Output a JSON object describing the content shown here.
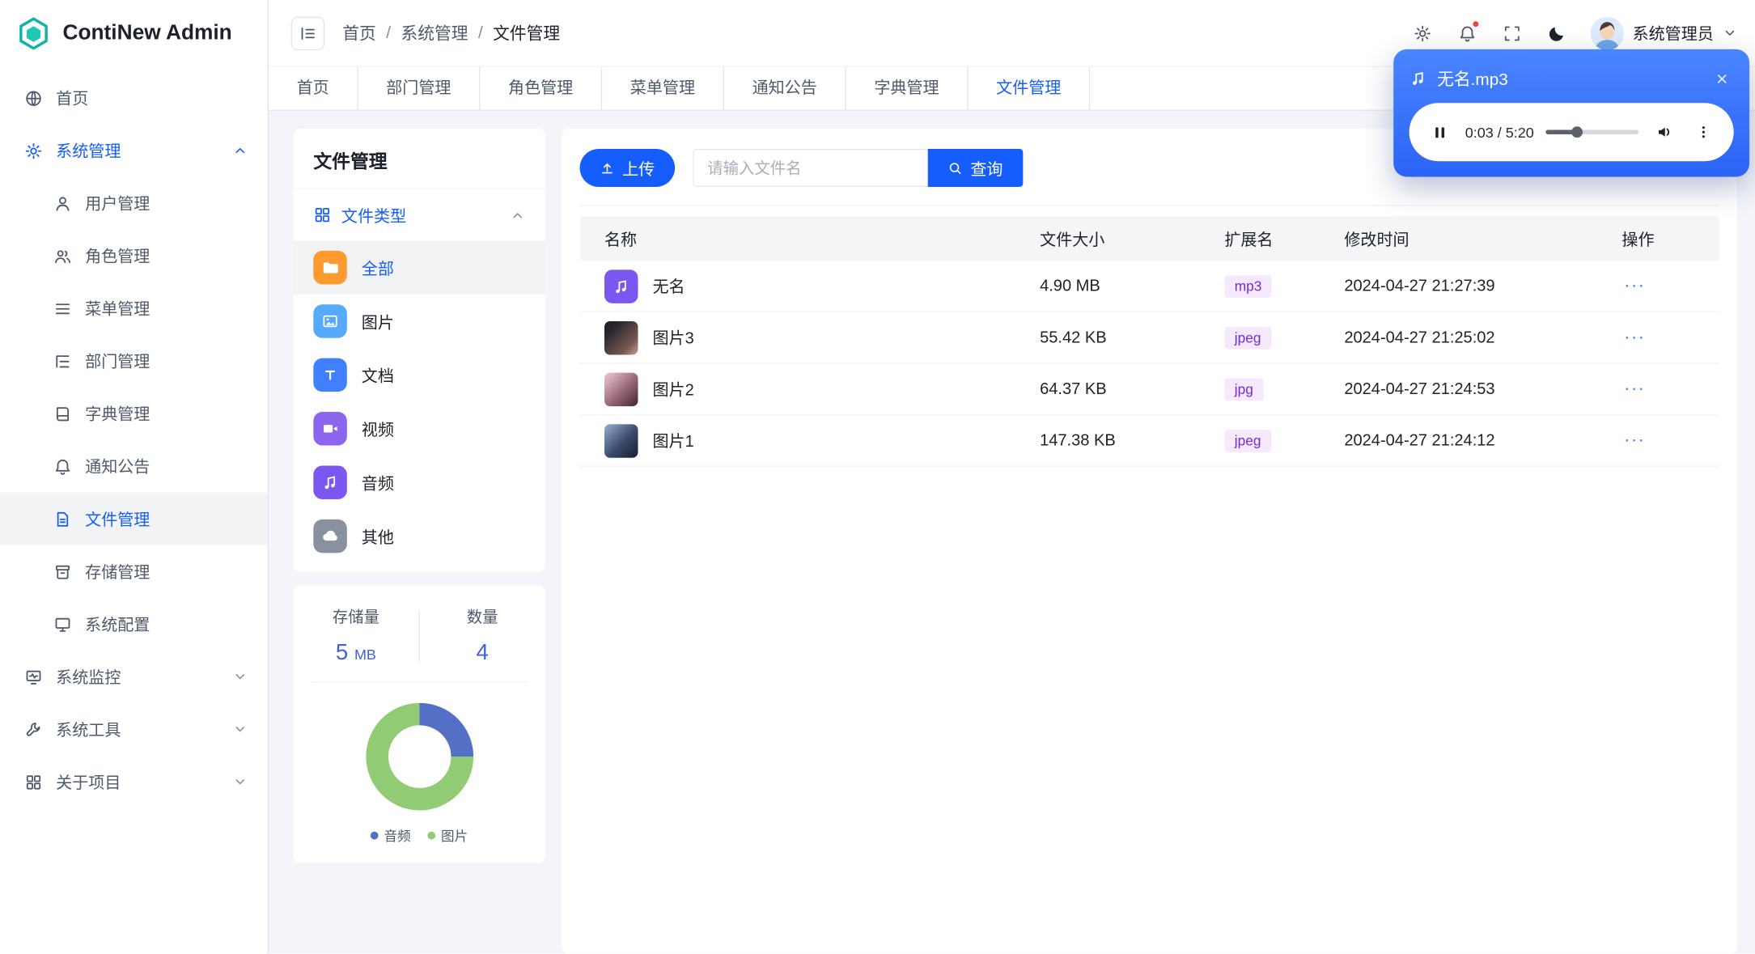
{
  "app": {
    "title": "ContiNew Admin"
  },
  "header": {
    "breadcrumb": [
      "首页",
      "系统管理",
      "文件管理"
    ],
    "separator": "/",
    "user_name": "系统管理员"
  },
  "sidebar": {
    "items": [
      {
        "label": "首页",
        "icon": "home-icon"
      },
      {
        "label": "系统管理",
        "icon": "gear-icon",
        "expanded": true
      },
      {
        "label": "用户管理",
        "icon": "user-icon"
      },
      {
        "label": "角色管理",
        "icon": "users-icon"
      },
      {
        "label": "菜单管理",
        "icon": "list-icon"
      },
      {
        "label": "部门管理",
        "icon": "tree-icon"
      },
      {
        "label": "字典管理",
        "icon": "book-icon"
      },
      {
        "label": "通知公告",
        "icon": "bell-icon"
      },
      {
        "label": "文件管理",
        "icon": "file-icon",
        "active": true
      },
      {
        "label": "存储管理",
        "icon": "archive-icon"
      },
      {
        "label": "系统配置",
        "icon": "monitor-icon"
      },
      {
        "label": "系统监控",
        "icon": "monitor-pulse-icon",
        "collapsed": true
      },
      {
        "label": "系统工具",
        "icon": "wrench-icon",
        "collapsed": true
      },
      {
        "label": "关于项目",
        "icon": "grid-icon",
        "collapsed": true
      }
    ]
  },
  "tabs": [
    "首页",
    "部门管理",
    "角色管理",
    "菜单管理",
    "通知公告",
    "字典管理",
    "文件管理"
  ],
  "active_tab": "文件管理",
  "file_panel": {
    "title": "文件管理",
    "group_label": "文件类型",
    "types": [
      {
        "label": "全部",
        "icon": "folder-icon",
        "active": true
      },
      {
        "label": "图片",
        "icon": "image-icon"
      },
      {
        "label": "文档",
        "icon": "document-icon"
      },
      {
        "label": "视频",
        "icon": "video-icon"
      },
      {
        "label": "音频",
        "icon": "audio-icon"
      },
      {
        "label": "其他",
        "icon": "cloud-icon"
      }
    ]
  },
  "stats": {
    "storage_label": "存储量",
    "storage_value": "5",
    "storage_unit": "MB",
    "count_label": "数量",
    "count_value": "4"
  },
  "chart_data": {
    "type": "pie",
    "donut": true,
    "labels": [
      "音频",
      "图片"
    ],
    "values": [
      1,
      3
    ],
    "colors": [
      "#5470c6",
      "#91cc75"
    ],
    "legend_position": "bottom"
  },
  "toolbar": {
    "upload_label": "上传",
    "search_placeholder": "请输入文件名",
    "search_label": "查询"
  },
  "table": {
    "headers": [
      "名称",
      "文件大小",
      "扩展名",
      "修改时间",
      "操作"
    ],
    "action_more": "···",
    "rows": [
      {
        "name": "无名",
        "size": "4.90 MB",
        "ext": "mp3",
        "time": "2024-04-27 21:27:39",
        "kind": "audio"
      },
      {
        "name": "图片3",
        "size": "55.42 KB",
        "ext": "jpeg",
        "time": "2024-04-27 21:25:02",
        "kind": "image"
      },
      {
        "name": "图片2",
        "size": "64.37 KB",
        "ext": "jpg",
        "time": "2024-04-27 21:24:53",
        "kind": "image"
      },
      {
        "name": "图片1",
        "size": "147.38 KB",
        "ext": "jpeg",
        "time": "2024-04-27 21:24:12",
        "kind": "image"
      }
    ]
  },
  "player": {
    "title": "无名.mp3",
    "time": "0:03 / 5:20",
    "progress_percent": 33
  },
  "colors": {
    "primary": "#165dff",
    "ext_badge_bg": "#f5e8ff",
    "ext_badge_text": "#722ed1",
    "player_gradient_start": "#4a85ff",
    "player_gradient_end": "#2b63f6"
  }
}
